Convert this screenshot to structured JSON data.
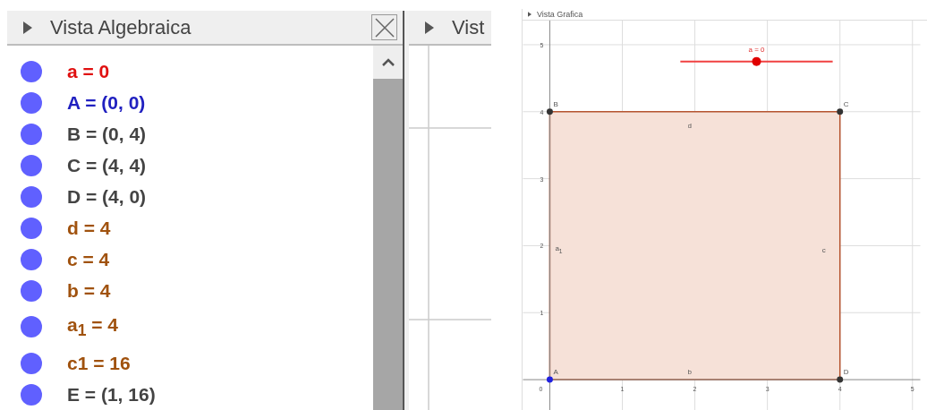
{
  "algebra_view": {
    "title": "Vista Algebraica",
    "objects": [
      {
        "text": "a = 0",
        "color": "#e01010"
      },
      {
        "text": "A = (0, 0)",
        "color": "#2020c0"
      },
      {
        "text": "B = (0, 4)",
        "color": "#444444"
      },
      {
        "text": "C = (4, 4)",
        "color": "#444444"
      },
      {
        "text": "D = (4, 0)",
        "color": "#444444"
      },
      {
        "text": "d = 4",
        "color": "#a0520e"
      },
      {
        "text": "c = 4",
        "color": "#a0520e"
      },
      {
        "text": "b = 4",
        "color": "#a0520e"
      },
      {
        "text": "a$_{1}$ = 4",
        "color": "#a0520e"
      },
      {
        "text": "c1 = 16",
        "color": "#a0520e"
      },
      {
        "text": "E = (1, 16)",
        "color": "#444444"
      }
    ]
  },
  "second_view": {
    "title": "Vist"
  },
  "graphics_view": {
    "title": "Vista Grafica",
    "slider": {
      "label": "a = 0",
      "level": 0.5
    },
    "x_ticks": [
      "0",
      "1",
      "2",
      "3",
      "4",
      "5"
    ],
    "y_ticks": [
      "5",
      "4",
      "3",
      "2",
      "1"
    ],
    "points": [
      {
        "label": "B",
        "color": "#333333"
      },
      {
        "label": "C",
        "color": "#333333"
      },
      {
        "label": "A",
        "color": "#2020e0"
      },
      {
        "label": "D",
        "color": "#333333"
      }
    ],
    "segment_labels": [
      "d",
      "c",
      "b",
      "a$_{1}$"
    ]
  }
}
